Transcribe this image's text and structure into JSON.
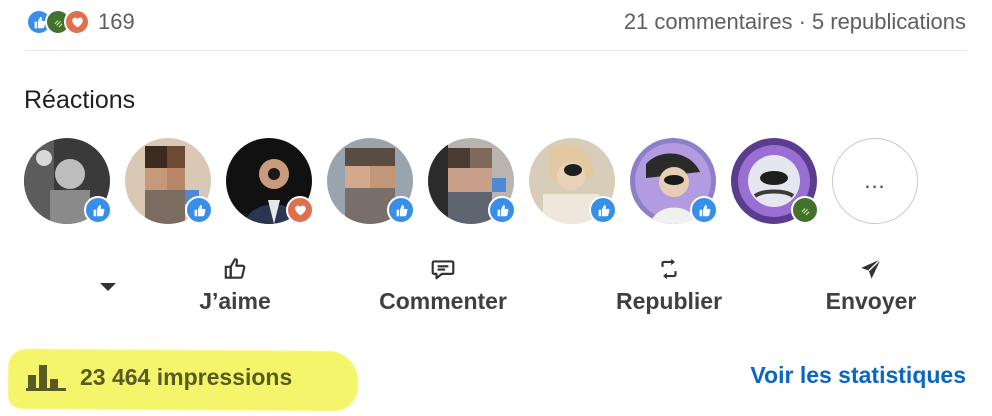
{
  "summary": {
    "reaction_icons": [
      "like-icon",
      "celebrate-icon",
      "love-icon"
    ],
    "reaction_count": "169",
    "comments": "21 commentaires",
    "separator": "·",
    "reposts": "5 republications"
  },
  "reactions": {
    "title": "Réactions",
    "avatars": [
      {
        "name": "reactor-avatar-1",
        "reaction": "like"
      },
      {
        "name": "reactor-avatar-2",
        "reaction": "like"
      },
      {
        "name": "reactor-avatar-3",
        "reaction": "love"
      },
      {
        "name": "reactor-avatar-4",
        "reaction": "like"
      },
      {
        "name": "reactor-avatar-5",
        "reaction": "like"
      },
      {
        "name": "reactor-avatar-6",
        "reaction": "like"
      },
      {
        "name": "reactor-avatar-7",
        "reaction": "like"
      },
      {
        "name": "reactor-avatar-8",
        "reaction": "celebrate"
      }
    ],
    "more_label": "..."
  },
  "actions": {
    "like": {
      "label": "J’aime",
      "icon": "thumbs-up-outline-icon"
    },
    "comment": {
      "label": "Commenter",
      "icon": "comment-bubble-icon"
    },
    "repost": {
      "label": "Republier",
      "icon": "repost-arrows-icon"
    },
    "send": {
      "label": "Envoyer",
      "icon": "paper-plane-icon"
    }
  },
  "footer": {
    "impressions": "23 464 impressions",
    "impressions_icon": "bar-chart-icon",
    "see_stats": "Voir les statistiques"
  },
  "colors": {
    "like": "#378fe9",
    "celebrate": "#44712e",
    "love": "#df704d",
    "link": "#0a66c2",
    "highlight": "#f4f56a"
  }
}
